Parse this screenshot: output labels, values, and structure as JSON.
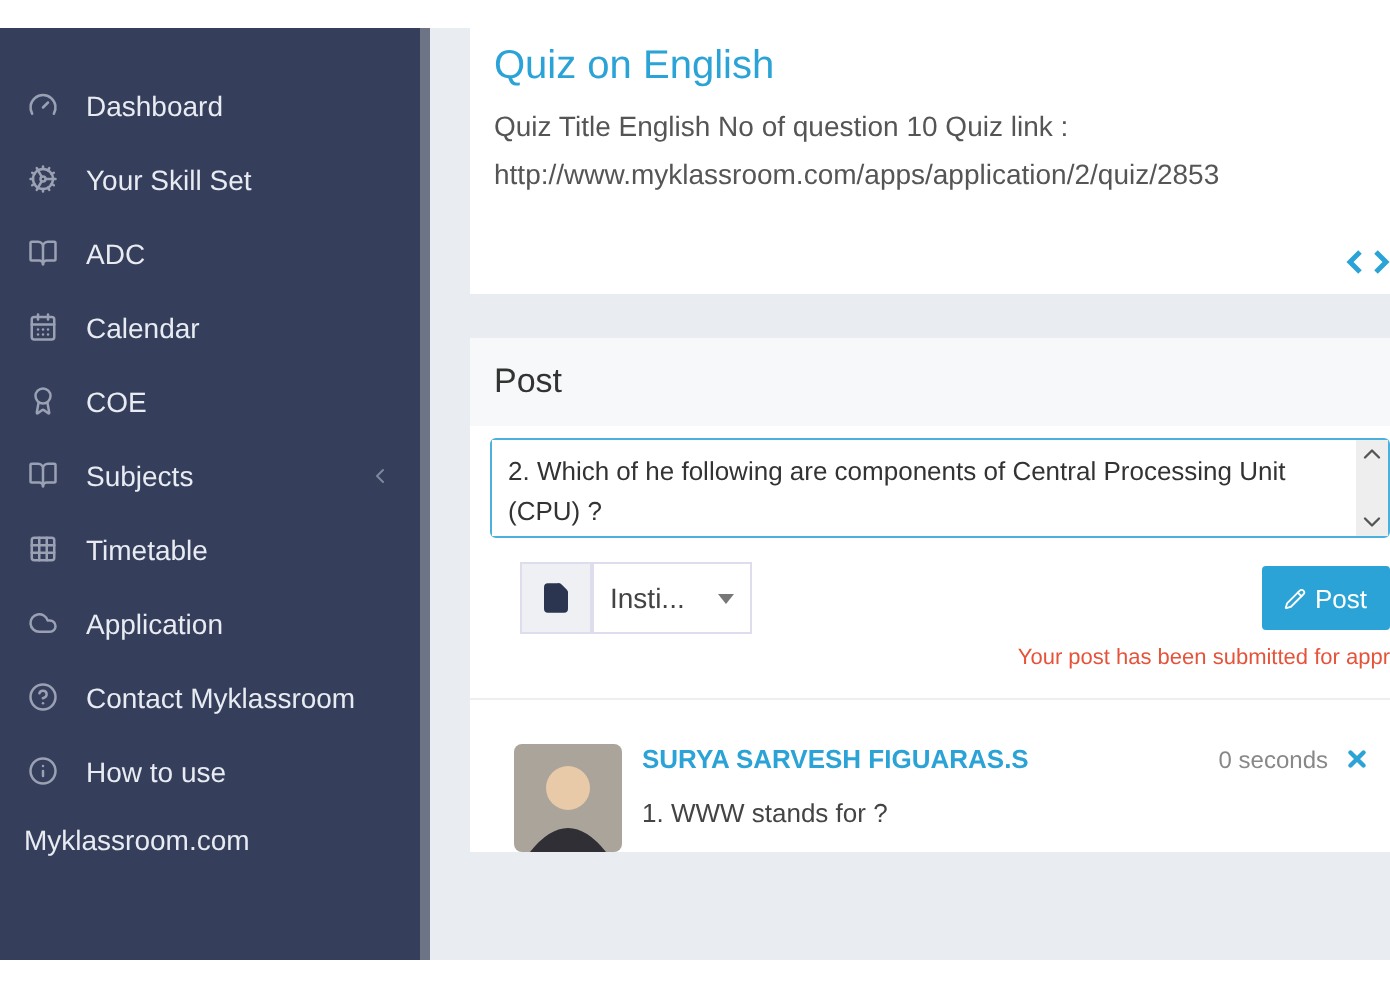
{
  "sidebar": {
    "items": [
      {
        "label": "Dashboard",
        "has_submenu": false
      },
      {
        "label": "Your Skill Set",
        "has_submenu": false
      },
      {
        "label": "ADC",
        "has_submenu": false
      },
      {
        "label": "Calendar",
        "has_submenu": false
      },
      {
        "label": "COE",
        "has_submenu": false
      },
      {
        "label": "Subjects",
        "has_submenu": true
      },
      {
        "label": "Timetable",
        "has_submenu": false
      },
      {
        "label": "Application",
        "has_submenu": false
      },
      {
        "label": "Contact Myklassroom",
        "has_submenu": false
      },
      {
        "label": "How to use",
        "has_submenu": false
      }
    ],
    "footer": "Myklassroom.com"
  },
  "quiz_card": {
    "title": "Quiz on English",
    "line_1": "Quiz Title English No of question 10 Quiz link :",
    "line_2": "http://www.myklassroom.com/apps/application/2/quiz/2853"
  },
  "post_card": {
    "title": "Post",
    "editor_value": "2. Which of he following are components of Central Processing Unit (CPU) ?",
    "audience": "Insti...",
    "button": "Post",
    "message": "Your post has been submitted for appr",
    "posts": [
      {
        "author": "SURYA SARVESH FIGUARAS.S",
        "time": "0 seconds",
        "text": "1. WWW stands for ?"
      }
    ]
  }
}
